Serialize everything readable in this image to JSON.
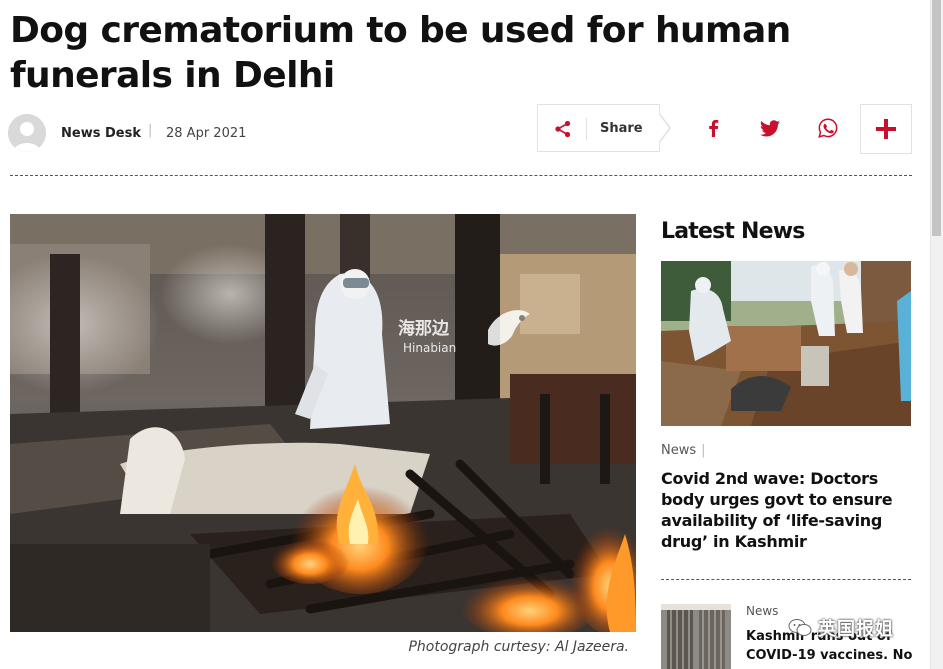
{
  "article": {
    "title": "Dog crematorium to be used for human funerals in Delhi",
    "author": "News Desk",
    "separator": "|",
    "date": "28 Apr 2021",
    "caption": "Photograph curtesy: Al Jazeera.",
    "image_watermark": {
      "cn": "海那边",
      "en": "Hinabian"
    }
  },
  "share": {
    "label": "Share",
    "icons": [
      "share-icon",
      "facebook-icon",
      "twitter-icon",
      "whatsapp-icon",
      "plus-icon"
    ]
  },
  "sidebar": {
    "section_title": "Latest News",
    "items": [
      {
        "category": "News",
        "separator": "|",
        "headline": "Covid 2nd wave: Doctors body urges govt to ensure availability of ‘life-saving drug’ in Kashmir"
      },
      {
        "category": "News",
        "headline": "Kashmir runs out of COVID-19 vaccines. No"
      }
    ]
  },
  "watermark": {
    "text": "英国报姐"
  },
  "colors": {
    "accent": "#c8102e",
    "text": "#111111",
    "border": "#e2e2e2"
  }
}
